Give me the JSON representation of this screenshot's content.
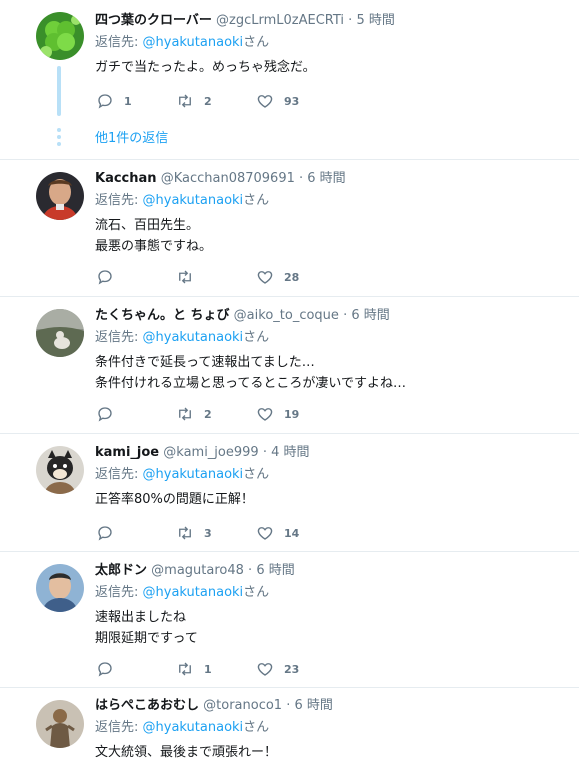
{
  "tweets": [
    {
      "name": "四つ葉のクローバー",
      "handle": "@zgcLrmL0zAECRTi",
      "time": "5 時間",
      "reply_label": "返信先:",
      "mention": "@hyakutanaoki",
      "mention_suffix": "さん",
      "lines": [
        "ガチで当たったよ。めっちゃ残念だ。"
      ],
      "replies": "1",
      "retweets": "2",
      "likes": "93",
      "avatar_icon": "clover-avatar"
    },
    {
      "name": "Kacchan",
      "handle": "@Kacchan08709691",
      "time": "6 時間",
      "reply_label": "返信先:",
      "mention": "@hyakutanaoki",
      "mention_suffix": "さん",
      "lines": [
        "流石、百田先生。",
        "最悪の事態ですね。"
      ],
      "replies": "",
      "retweets": "",
      "likes": "28",
      "avatar_icon": "person-avatar"
    },
    {
      "name": "たくちゃん。と ちょび",
      "handle": "@aiko_to_coque",
      "time": "6 時間",
      "reply_label": "返信先:",
      "mention": "@hyakutanaoki",
      "mention_suffix": "さん",
      "lines": [
        "条件付きで延長って速報出てました…",
        "条件付けれる立場と思ってるところが凄いですよね…"
      ],
      "replies": "",
      "retweets": "2",
      "likes": "19",
      "avatar_icon": "landscape-avatar"
    },
    {
      "name": "kami_joe",
      "handle": "@kami_joe999",
      "time": "4 時間",
      "reply_label": "返信先:",
      "mention": "@hyakutanaoki",
      "mention_suffix": "さん",
      "lines": [
        "正答率80%の問題に正解！"
      ],
      "replies": "",
      "retweets": "3",
      "likes": "14",
      "avatar_icon": "dog-avatar"
    },
    {
      "name": "太郎ドン",
      "handle": "@magutaro48",
      "time": "6 時間",
      "reply_label": "返信先:",
      "mention": "@hyakutanaoki",
      "mention_suffix": "さん",
      "lines": [
        "速報出ましたね",
        "期限延期ですって"
      ],
      "replies": "",
      "retweets": "1",
      "likes": "23",
      "avatar_icon": "person-avatar"
    },
    {
      "name": "はらぺこあおむし",
      "handle": "@toranoco1",
      "time": "6 時間",
      "reply_label": "返信先:",
      "mention": "@hyakutanaoki",
      "mention_suffix": "さん",
      "lines": [
        "文大統領、最後まで頑張れー！"
      ],
      "avatar_icon": "figure-avatar"
    }
  ],
  "more_replies_label": "他1件の返信",
  "dot": "·",
  "colors": {
    "accent": "#1da1f2",
    "muted": "#657786",
    "thread": "#b8e0f7",
    "divider": "#e6ecf0"
  }
}
